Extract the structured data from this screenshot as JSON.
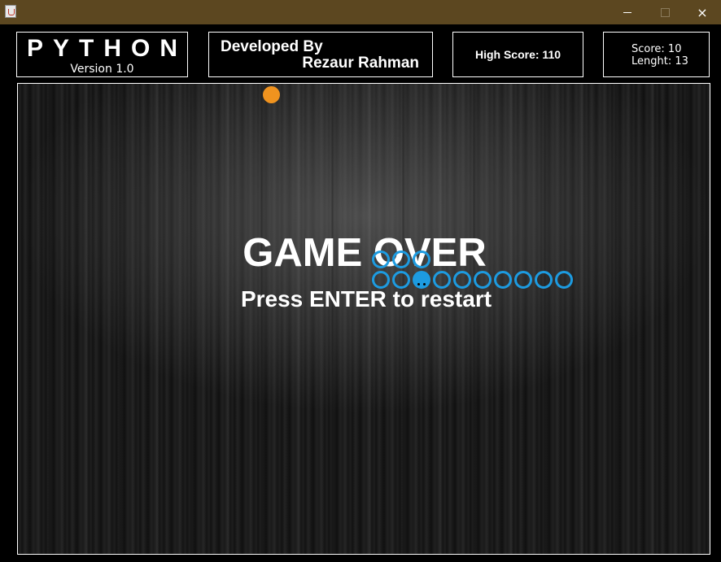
{
  "window": {
    "title": "",
    "controls": {
      "minimize": "minimize-icon",
      "maximize": "maximize-icon",
      "close": "×"
    }
  },
  "header": {
    "title": "PYTHON",
    "version": "Version 1.0",
    "developer_label": "Developed By",
    "developer_name": "Rezaur Rahman",
    "high_score": "High Score: 110",
    "score": "Score: 10",
    "length": "Lenght: 13"
  },
  "game": {
    "status_title": "GAME OVER",
    "status_subtitle": "Press ENTER to restart",
    "food_color": "#f0931f",
    "snake_color": "#1d9be0",
    "grid_cell": 25,
    "food": {
      "col": 12,
      "row": 0
    },
    "snake": {
      "head": {
        "col": 19,
        "row": 9
      },
      "body": [
        {
          "col": 17,
          "row": 8
        },
        {
          "col": 18,
          "row": 8
        },
        {
          "col": 19,
          "row": 8
        },
        {
          "col": 17,
          "row": 9
        },
        {
          "col": 18,
          "row": 9
        },
        {
          "col": 20,
          "row": 9
        },
        {
          "col": 21,
          "row": 9
        },
        {
          "col": 22,
          "row": 9
        },
        {
          "col": 23,
          "row": 9
        },
        {
          "col": 24,
          "row": 9
        },
        {
          "col": 25,
          "row": 9
        },
        {
          "col": 26,
          "row": 9
        }
      ]
    }
  }
}
